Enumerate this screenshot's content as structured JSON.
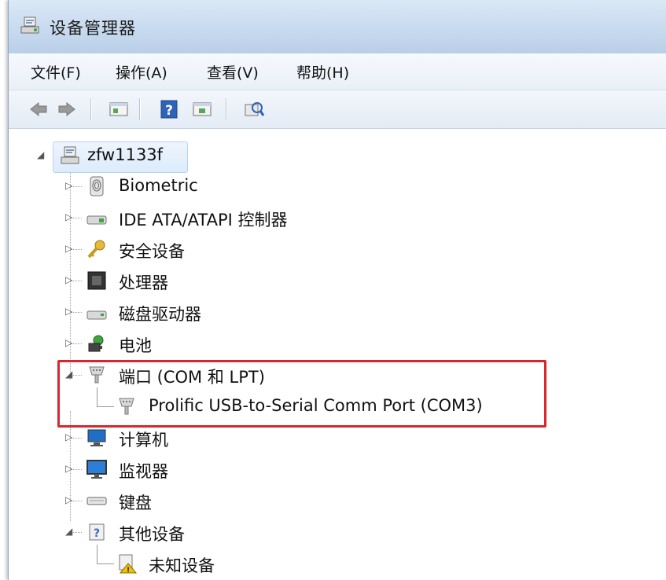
{
  "window": {
    "title": "设备管理器"
  },
  "menu": {
    "file": "文件(F)",
    "action": "操作(A)",
    "view": "查看(V)",
    "help": "帮助(H)"
  },
  "toolbar": {
    "buttons": [
      "back-arrow-icon",
      "forward-arrow-icon",
      "properties-icon",
      "help-icon",
      "update-driver-icon",
      "scan-hardware-icon"
    ]
  },
  "tree": {
    "root": "zfw1133f",
    "items": [
      {
        "label": "Biometric",
        "icon": "fingerprint-icon",
        "expanded": false
      },
      {
        "label": "IDE ATA/ATAPI 控制器",
        "icon": "ide-controller-icon",
        "expanded": false
      },
      {
        "label": "安全设备",
        "icon": "key-icon",
        "expanded": false
      },
      {
        "label": "处理器",
        "icon": "processor-icon",
        "expanded": false
      },
      {
        "label": "磁盘驱动器",
        "icon": "disk-drive-icon",
        "expanded": false
      },
      {
        "label": "电池",
        "icon": "battery-icon",
        "expanded": false
      },
      {
        "label": "端口 (COM 和 LPT)",
        "icon": "port-icon",
        "expanded": true,
        "children": [
          {
            "label": "Prolific USB-to-Serial Comm Port (COM3)",
            "icon": "port-icon"
          }
        ]
      },
      {
        "label": "计算机",
        "icon": "computer-icon",
        "expanded": false
      },
      {
        "label": "监视器",
        "icon": "monitor-icon",
        "expanded": false
      },
      {
        "label": "键盘",
        "icon": "keyboard-icon",
        "expanded": false
      },
      {
        "label": "其他设备",
        "icon": "unknown-device-icon",
        "expanded": true,
        "children": [
          {
            "label": "未知设备",
            "icon": "unknown-device-warning-icon"
          }
        ]
      }
    ]
  },
  "highlight_color": "#d9262c"
}
